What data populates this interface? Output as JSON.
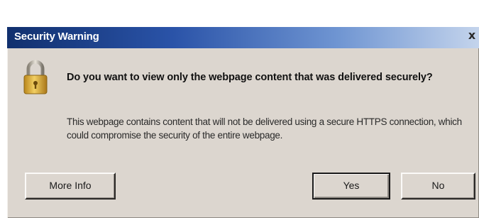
{
  "window": {
    "title": "Security Warning",
    "close_icon": "close-icon",
    "close_glyph": "x"
  },
  "message": {
    "icon": "lock-icon",
    "heading": "Do you want to view only the webpage content that was delivered securely?",
    "body": "This webpage contains content that will not be delivered using a secure HTTPS connection, which could compromise the security of the entire webpage."
  },
  "buttons": {
    "more_info": "More Info",
    "yes": "Yes",
    "no": "No"
  },
  "colors": {
    "titlebar_start": "#11306e",
    "titlebar_end": "#c4d4ec",
    "dialog_background": "#dcd6cf",
    "lock_body": "#d9a52b"
  }
}
